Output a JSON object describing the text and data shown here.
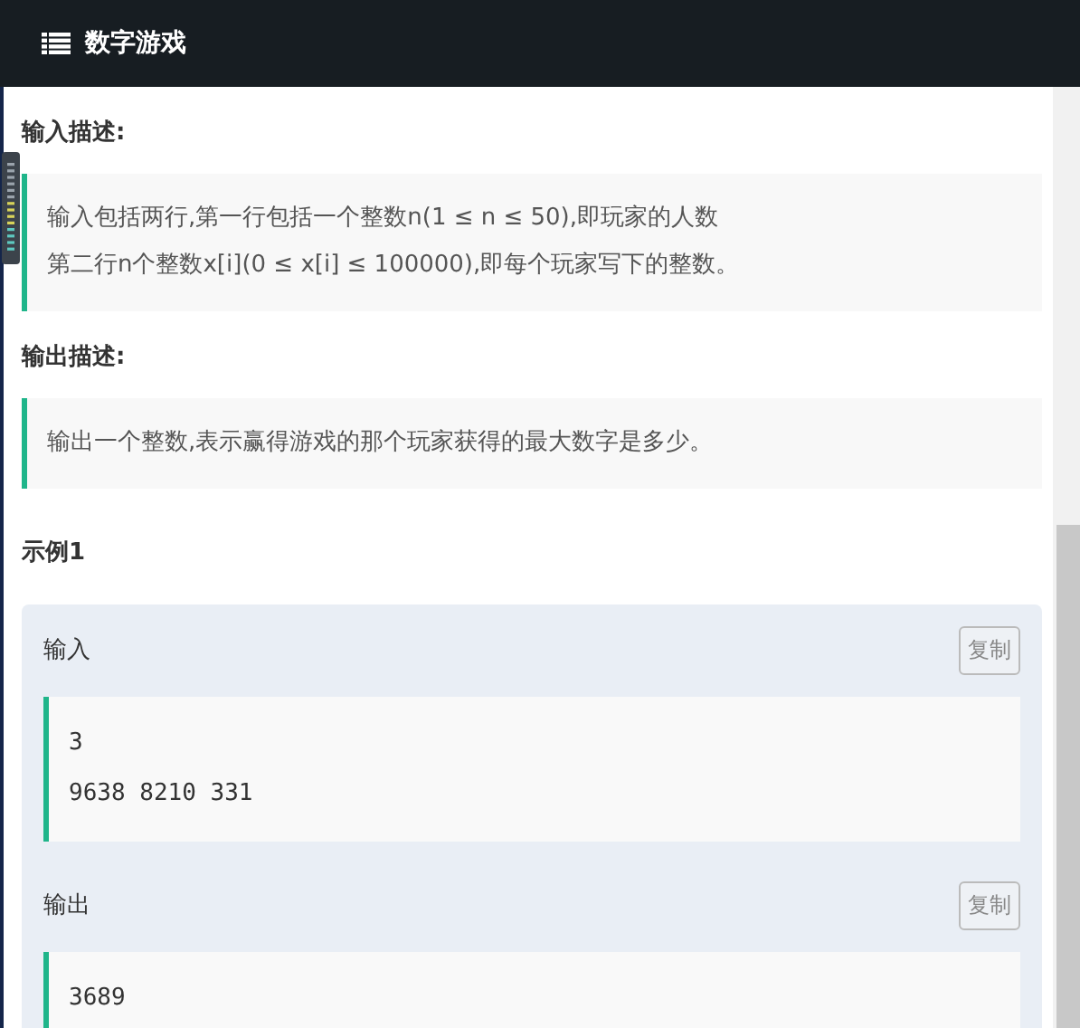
{
  "header": {
    "title": "数字游戏"
  },
  "sections": [
    {
      "title": "输入描述:",
      "lines": [
        "输入包括两行,第一行包括一个整数n(1 ≤ n ≤ 50),即玩家的人数",
        "第二行n个整数x[i](0 ≤ x[i] ≤ 100000),即每个玩家写下的整数。"
      ]
    },
    {
      "title": "输出描述:",
      "lines": [
        "输出一个整数,表示赢得游戏的那个玩家获得的最大数字是多少。"
      ]
    }
  ],
  "example": {
    "title": "示例1",
    "blocks": [
      {
        "label": "输入",
        "button": "复制",
        "lines": [
          "3",
          "9638 8210 331"
        ]
      },
      {
        "label": "输出",
        "button": "复制",
        "lines": [
          "3689"
        ]
      }
    ]
  }
}
